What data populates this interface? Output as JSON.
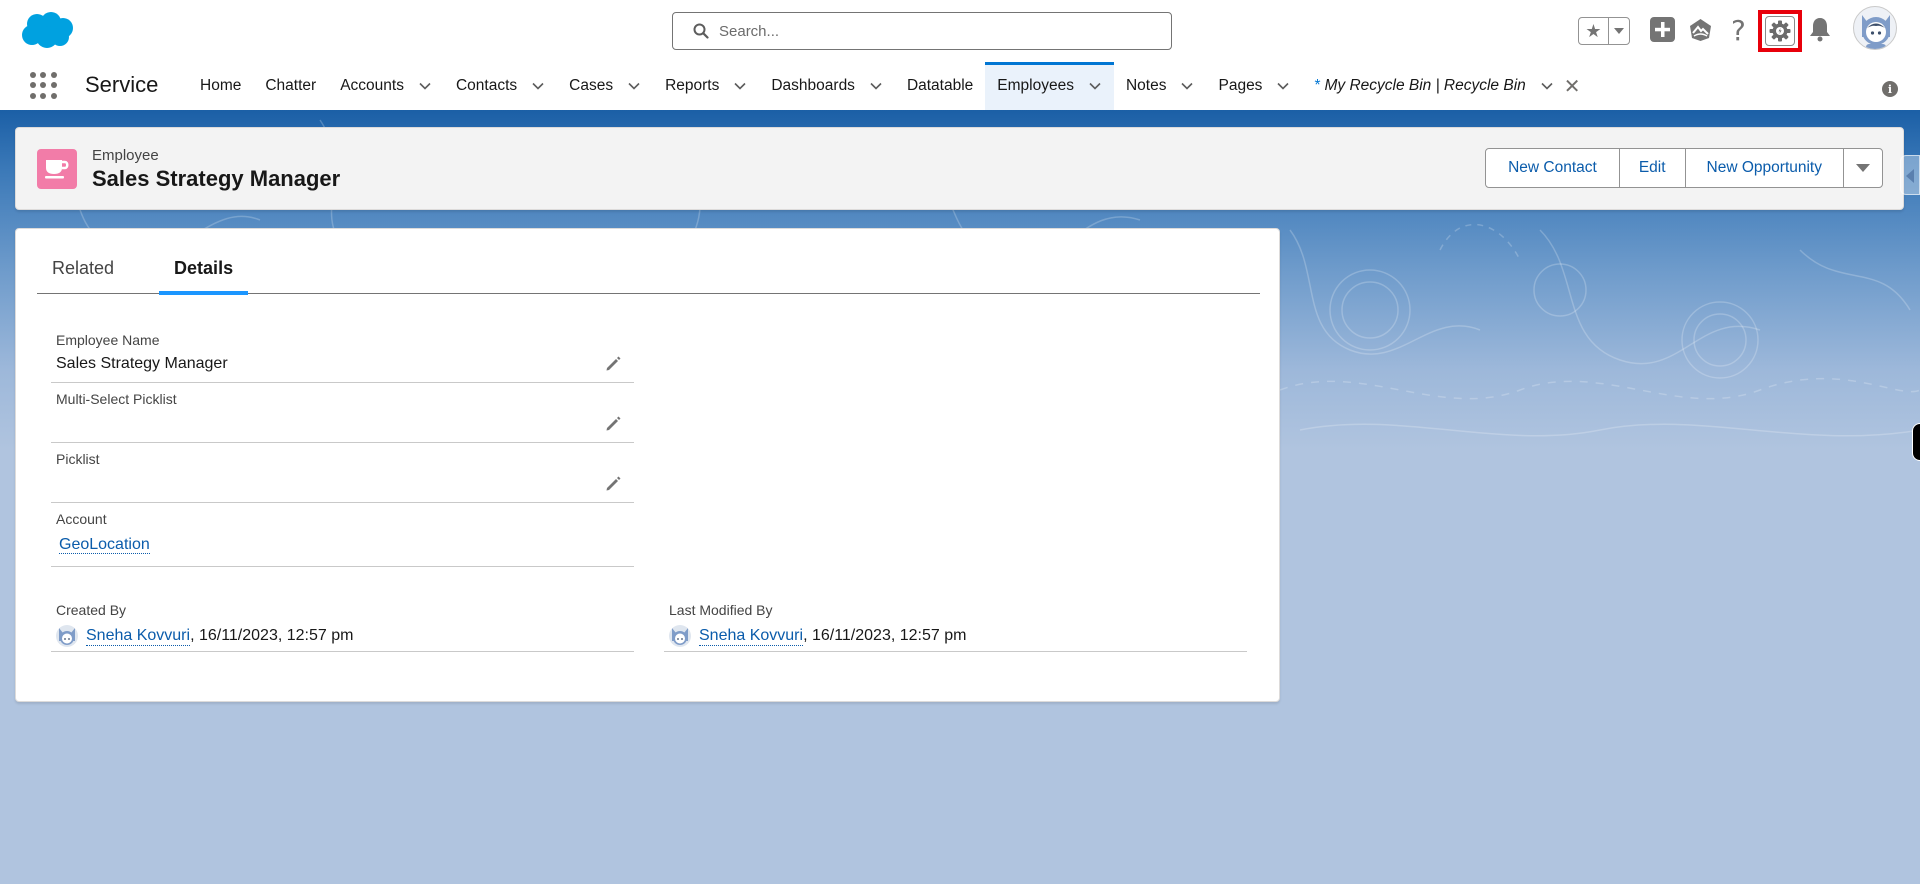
{
  "header": {
    "search_placeholder": "Search...",
    "icons": {
      "logo": "salesforce-cloud-logo",
      "favorites": "star-icon",
      "favorites_menu": "caret-down-icon",
      "global_actions": "plus-icon",
      "trailhead": "trailhead-icon",
      "help": "question-icon",
      "setup": "gear-icon",
      "notifications": "bell-icon",
      "profile": "avatar"
    },
    "highlight_color": "#e8000b"
  },
  "nav": {
    "app_name": "Service",
    "items": [
      {
        "label": "Home",
        "has_menu": false
      },
      {
        "label": "Chatter",
        "has_menu": false
      },
      {
        "label": "Accounts",
        "has_menu": true
      },
      {
        "label": "Contacts",
        "has_menu": true
      },
      {
        "label": "Cases",
        "has_menu": true
      },
      {
        "label": "Reports",
        "has_menu": true
      },
      {
        "label": "Dashboards",
        "has_menu": true
      },
      {
        "label": "Datatable",
        "has_menu": false
      },
      {
        "label": "Employees",
        "has_menu": true,
        "active": true
      },
      {
        "label": "Notes",
        "has_menu": true
      },
      {
        "label": "Pages",
        "has_menu": true
      },
      {
        "label": "My Recycle Bin | Recycle Bin",
        "has_menu": true,
        "unsaved_marker": "*",
        "closable": true,
        "italic": true
      }
    ],
    "accent_color": "#0176d3"
  },
  "record": {
    "object_type": "Employee",
    "title": "Sales Strategy Manager",
    "icon_color": "#f27ca8",
    "actions": [
      "New Contact",
      "Edit",
      "New Opportunity"
    ]
  },
  "tabs": [
    {
      "label": "Related",
      "active": false
    },
    {
      "label": "Details",
      "active": true
    }
  ],
  "details": {
    "employee_name": {
      "label": "Employee Name",
      "value": "Sales Strategy Manager"
    },
    "multi_select_picklist": {
      "label": "Multi-Select Picklist",
      "value": ""
    },
    "picklist": {
      "label": "Picklist",
      "value": ""
    },
    "account": {
      "label": "Account",
      "value": "GeoLocation"
    },
    "created_by": {
      "label": "Created By",
      "user": "Sneha Kovvuri",
      "timestamp": ", 16/11/2023, 12:57 pm"
    },
    "last_modified_by": {
      "label": "Last Modified By",
      "user": "Sneha Kovvuri",
      "timestamp": ", 16/11/2023, 12:57 pm"
    }
  }
}
